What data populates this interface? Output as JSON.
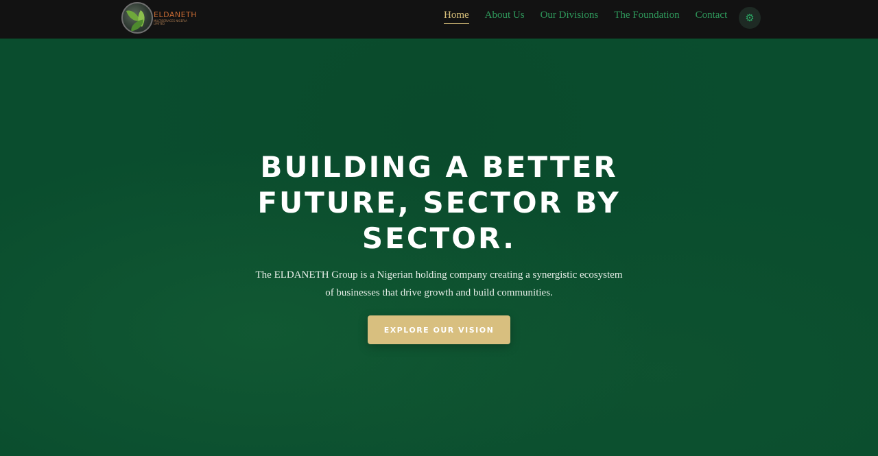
{
  "brand": {
    "name": "ELDANETH",
    "tagline": "MULTISERVICES NIGERIA LIMITED"
  },
  "nav": {
    "items": [
      {
        "label": "Home",
        "active": true
      },
      {
        "label": "About Us",
        "active": false
      },
      {
        "label": "Our Divisions",
        "active": false
      },
      {
        "label": "The Foundation",
        "active": false
      },
      {
        "label": "Contact",
        "active": false
      }
    ],
    "theme_toggle_icon": "sun-icon"
  },
  "hero": {
    "title": "BUILDING A BETTER FUTURE, SECTOR BY SECTOR.",
    "subtitle": "The ELDANETH Group is a Nigerian holding company creating a synergistic ecosystem of businesses that drive growth and build communities.",
    "cta_label": "EXPLORE OUR VISION"
  },
  "colors": {
    "nav_bg": "#121212",
    "hero_bg": "#0a4d2e",
    "accent_gold": "#d8bf7f",
    "nav_link": "#2f9a5c"
  }
}
